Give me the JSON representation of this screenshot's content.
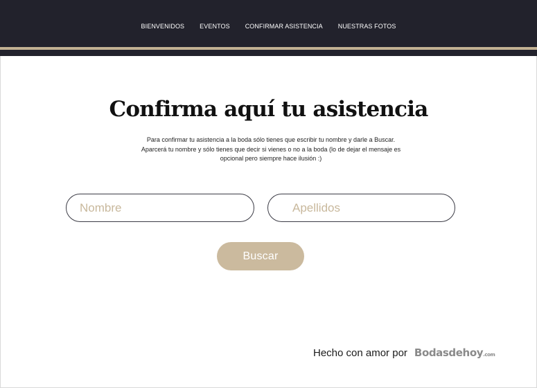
{
  "nav": {
    "items": [
      {
        "label": "BIENVENIDOS"
      },
      {
        "label": "EVENTOS"
      },
      {
        "label": "CONFIRMAR ASISTENCIA"
      },
      {
        "label": "NUESTRAS FOTOS"
      }
    ]
  },
  "colors": {
    "header_bg": "#22222c",
    "accent_gold": "#c2b192",
    "button_bg": "#cbba9e",
    "placeholder": "#c8b89c"
  },
  "main": {
    "title": "Confirma aquí tu asistencia",
    "description": "Para confirmar tu asistencia a la boda sólo tienes que escribir tu nombre y darle a Buscar. Aparcerá tu nombre y sólo tienes que decir si vienes o no a la boda (lo de dejar el mensaje es opcional pero siempre hace ilusión :)"
  },
  "form": {
    "first_name": {
      "value": "",
      "placeholder": "Nombre"
    },
    "last_name": {
      "value": "",
      "placeholder": "Apellidos"
    },
    "search_label": "Buscar"
  },
  "footer": {
    "text": "Hecho con amor por",
    "brand": "Bodasdehoy",
    "brand_suffix": ".com"
  }
}
